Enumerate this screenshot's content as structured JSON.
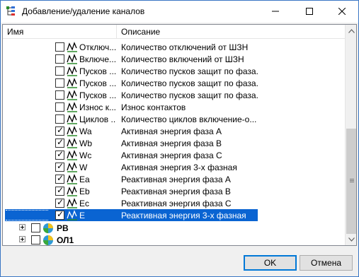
{
  "window": {
    "title": "Добавление/удаление каналов"
  },
  "columns": {
    "name": "Имя",
    "description": "Описание"
  },
  "channels": [
    {
      "name": "Отключ...",
      "description": "Количество отключений от ШЗН",
      "checked": false,
      "selected": false
    },
    {
      "name": "Включе...",
      "description": "Количество включений от ШЗН",
      "checked": false,
      "selected": false
    },
    {
      "name": "Пусков ...",
      "description": "Количество пусков защит по фаза...",
      "checked": false,
      "selected": false
    },
    {
      "name": "Пусков ...",
      "description": "Количество пусков защит по фаза...",
      "checked": false,
      "selected": false
    },
    {
      "name": "Пусков ...",
      "description": "Количество пусков защит по фаза...",
      "checked": false,
      "selected": false
    },
    {
      "name": "Износ к...",
      "description": "Износ контактов",
      "checked": false,
      "selected": false
    },
    {
      "name": "Циклов ...",
      "description": "Количество циклов включение-о...",
      "checked": false,
      "selected": false
    },
    {
      "name": "Wa",
      "description": "Активная энергия фаза A",
      "checked": true,
      "selected": false
    },
    {
      "name": "Wb",
      "description": "Активная энергия фаза B",
      "checked": true,
      "selected": false
    },
    {
      "name": "Wc",
      "description": "Активная энергия фаза C",
      "checked": true,
      "selected": false
    },
    {
      "name": "W",
      "description": "Активная энергия 3-х фазная",
      "checked": true,
      "selected": false
    },
    {
      "name": "Ea",
      "description": "Реактивная энергия фаза A",
      "checked": true,
      "selected": false
    },
    {
      "name": "Eb",
      "description": "Реактивная энергия фаза B",
      "checked": true,
      "selected": false
    },
    {
      "name": "Ec",
      "description": "Реактивная энергия фаза C",
      "checked": true,
      "selected": false
    },
    {
      "name": "E",
      "description": "Реактивная энергия 3-х фазная",
      "checked": true,
      "selected": true
    }
  ],
  "groups": [
    {
      "label": "РВ",
      "checked": false
    },
    {
      "label": "ОЛ1",
      "checked": false
    }
  ],
  "buttons": {
    "ok": "OK",
    "cancel": "Отмена"
  },
  "icons": {
    "app": "tree-network-icon",
    "channel": "signal-wave-icon",
    "group": "device-ball-icon"
  },
  "colors": {
    "selection": "#0a64d2",
    "accent": "#0078d7",
    "wave_green": "#2a8a2a"
  }
}
